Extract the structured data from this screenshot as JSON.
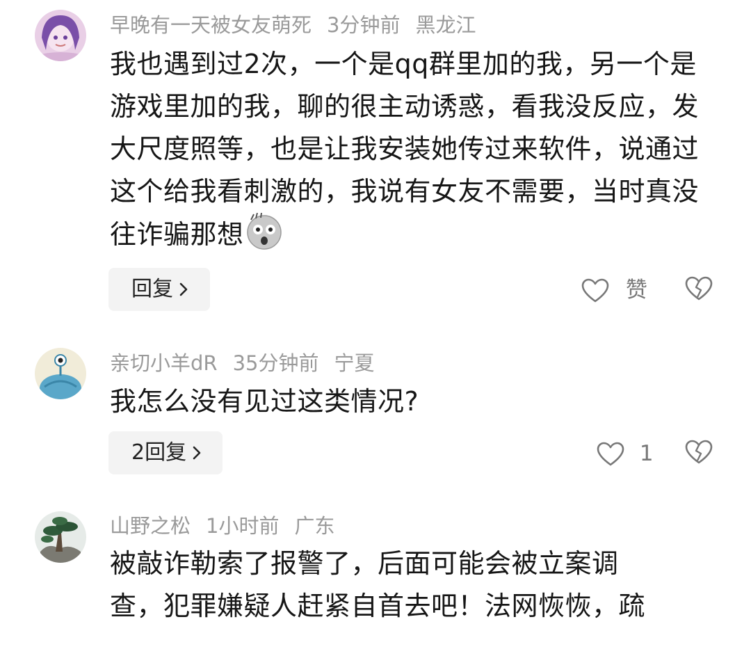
{
  "comments": [
    {
      "username": "早晚有一天被女友萌死",
      "time": "3分钟前",
      "location": "黑龙江",
      "avatar_icon": "anime-girl-avatar",
      "text": "我也遇到过2次，一个是qq群里加的我，另一个是游戏里加的我，聊的很主动诱惑，看我没反应，发大尺度照等，也是让我安装她传过来软件，说通过这个给我看刺激的，我说有女友不需要，当时真没往诈骗那想",
      "emoji_icon": "shocked-face-emoji",
      "reply_label": "回复",
      "like_label": "赞"
    },
    {
      "username": "亲切小羊dR",
      "time": "35分钟前",
      "location": "宁夏",
      "avatar_icon": "blue-monster-avatar",
      "text": "我怎么没有见过这类情况?",
      "reply_label": "2回复",
      "like_label": "1"
    },
    {
      "username": "山野之松",
      "time": "1小时前",
      "location": "广东",
      "avatar_icon": "pine-tree-avatar",
      "text_line1": "被敲诈勒索了报警了，后面可能会被立案调",
      "text_line2": "查，犯罪嫌疑人赶紧自首去吧！法网恢恢，疏"
    }
  ],
  "icons": {
    "like": "heart-outline-icon",
    "dislike": "broken-heart-icon",
    "chevron": "chevron-right-icon"
  },
  "colors": {
    "meta_text": "#9a9a9a",
    "body_text": "#161616",
    "reply_bg": "#f3f3f3"
  }
}
